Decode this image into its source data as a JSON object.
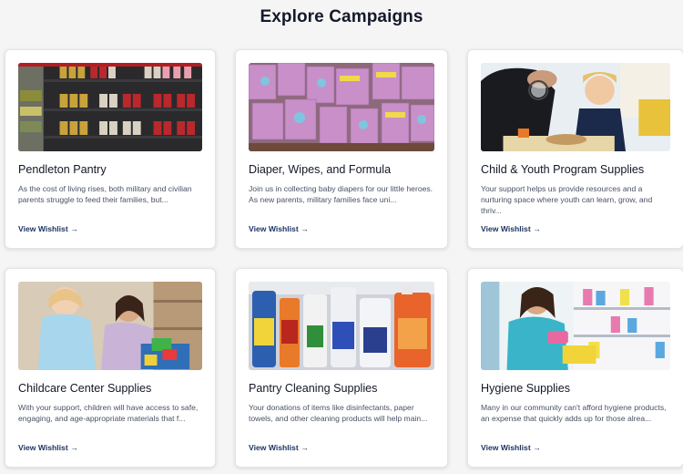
{
  "page": {
    "title": "Explore Campaigns"
  },
  "cards": [
    {
      "title": "Pendleton Pantry",
      "description": "As the cost of living rises, both military and civilian parents struggle to feed their families, but...",
      "link": "View Wishlist →"
    },
    {
      "title": "Diaper, Wipes, and Formula",
      "description": "Join us in collecting baby diapers for our little heroes. As new parents, military families face uni...",
      "link": "View Wishlist →"
    },
    {
      "title": "Child & Youth Program Supplies",
      "description": "Your support helps us provide resources and a nurturing space where youth can learn, grow, and thriv...",
      "link": "View Wishlist →"
    },
    {
      "title": "Childcare Center Supplies",
      "description": "With your support, children will have access to safe, engaging, and age-appropriate materials that f...",
      "link": "View Wishlist →"
    },
    {
      "title": "Pantry Cleaning Supplies",
      "description": "Your donations of items like disinfectants, paper towels, and other cleaning products will help main...",
      "link": "View Wishlist →"
    },
    {
      "title": "Hygiene Supplies",
      "description": "Many in our community can't afford hygiene products, an expense that quickly adds up for those alrea...",
      "link": "View Wishlist →"
    }
  ],
  "colors": {
    "background": "#f5f5f6",
    "card": "#ffffff",
    "link": "#1d3563",
    "title": "#15192b"
  }
}
